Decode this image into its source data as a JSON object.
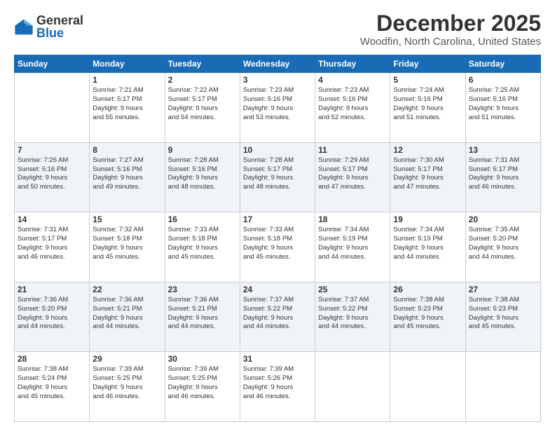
{
  "header": {
    "logo_general": "General",
    "logo_blue": "Blue",
    "month_title": "December 2025",
    "location": "Woodfin, North Carolina, United States"
  },
  "days_of_week": [
    "Sunday",
    "Monday",
    "Tuesday",
    "Wednesday",
    "Thursday",
    "Friday",
    "Saturday"
  ],
  "weeks": [
    [
      {
        "day": "",
        "info": ""
      },
      {
        "day": "1",
        "info": "Sunrise: 7:21 AM\nSunset: 5:17 PM\nDaylight: 9 hours\nand 55 minutes."
      },
      {
        "day": "2",
        "info": "Sunrise: 7:22 AM\nSunset: 5:17 PM\nDaylight: 9 hours\nand 54 minutes."
      },
      {
        "day": "3",
        "info": "Sunrise: 7:23 AM\nSunset: 5:16 PM\nDaylight: 9 hours\nand 53 minutes."
      },
      {
        "day": "4",
        "info": "Sunrise: 7:23 AM\nSunset: 5:16 PM\nDaylight: 9 hours\nand 52 minutes."
      },
      {
        "day": "5",
        "info": "Sunrise: 7:24 AM\nSunset: 5:16 PM\nDaylight: 9 hours\nand 51 minutes."
      },
      {
        "day": "6",
        "info": "Sunrise: 7:25 AM\nSunset: 5:16 PM\nDaylight: 9 hours\nand 51 minutes."
      }
    ],
    [
      {
        "day": "7",
        "info": "Sunrise: 7:26 AM\nSunset: 5:16 PM\nDaylight: 9 hours\nand 50 minutes."
      },
      {
        "day": "8",
        "info": "Sunrise: 7:27 AM\nSunset: 5:16 PM\nDaylight: 9 hours\nand 49 minutes."
      },
      {
        "day": "9",
        "info": "Sunrise: 7:28 AM\nSunset: 5:16 PM\nDaylight: 9 hours\nand 48 minutes."
      },
      {
        "day": "10",
        "info": "Sunrise: 7:28 AM\nSunset: 5:17 PM\nDaylight: 9 hours\nand 48 minutes."
      },
      {
        "day": "11",
        "info": "Sunrise: 7:29 AM\nSunset: 5:17 PM\nDaylight: 9 hours\nand 47 minutes."
      },
      {
        "day": "12",
        "info": "Sunrise: 7:30 AM\nSunset: 5:17 PM\nDaylight: 9 hours\nand 47 minutes."
      },
      {
        "day": "13",
        "info": "Sunrise: 7:31 AM\nSunset: 5:17 PM\nDaylight: 9 hours\nand 46 minutes."
      }
    ],
    [
      {
        "day": "14",
        "info": "Sunrise: 7:31 AM\nSunset: 5:17 PM\nDaylight: 9 hours\nand 46 minutes."
      },
      {
        "day": "15",
        "info": "Sunrise: 7:32 AM\nSunset: 5:18 PM\nDaylight: 9 hours\nand 45 minutes."
      },
      {
        "day": "16",
        "info": "Sunrise: 7:33 AM\nSunset: 5:18 PM\nDaylight: 9 hours\nand 45 minutes."
      },
      {
        "day": "17",
        "info": "Sunrise: 7:33 AM\nSunset: 5:18 PM\nDaylight: 9 hours\nand 45 minutes."
      },
      {
        "day": "18",
        "info": "Sunrise: 7:34 AM\nSunset: 5:19 PM\nDaylight: 9 hours\nand 44 minutes."
      },
      {
        "day": "19",
        "info": "Sunrise: 7:34 AM\nSunset: 5:19 PM\nDaylight: 9 hours\nand 44 minutes."
      },
      {
        "day": "20",
        "info": "Sunrise: 7:35 AM\nSunset: 5:20 PM\nDaylight: 9 hours\nand 44 minutes."
      }
    ],
    [
      {
        "day": "21",
        "info": "Sunrise: 7:36 AM\nSunset: 5:20 PM\nDaylight: 9 hours\nand 44 minutes."
      },
      {
        "day": "22",
        "info": "Sunrise: 7:36 AM\nSunset: 5:21 PM\nDaylight: 9 hours\nand 44 minutes."
      },
      {
        "day": "23",
        "info": "Sunrise: 7:36 AM\nSunset: 5:21 PM\nDaylight: 9 hours\nand 44 minutes."
      },
      {
        "day": "24",
        "info": "Sunrise: 7:37 AM\nSunset: 5:22 PM\nDaylight: 9 hours\nand 44 minutes."
      },
      {
        "day": "25",
        "info": "Sunrise: 7:37 AM\nSunset: 5:22 PM\nDaylight: 9 hours\nand 44 minutes."
      },
      {
        "day": "26",
        "info": "Sunrise: 7:38 AM\nSunset: 5:23 PM\nDaylight: 9 hours\nand 45 minutes."
      },
      {
        "day": "27",
        "info": "Sunrise: 7:38 AM\nSunset: 5:23 PM\nDaylight: 9 hours\nand 45 minutes."
      }
    ],
    [
      {
        "day": "28",
        "info": "Sunrise: 7:38 AM\nSunset: 5:24 PM\nDaylight: 9 hours\nand 45 minutes."
      },
      {
        "day": "29",
        "info": "Sunrise: 7:39 AM\nSunset: 5:25 PM\nDaylight: 9 hours\nand 46 minutes."
      },
      {
        "day": "30",
        "info": "Sunrise: 7:39 AM\nSunset: 5:25 PM\nDaylight: 9 hours\nand 46 minutes."
      },
      {
        "day": "31",
        "info": "Sunrise: 7:39 AM\nSunset: 5:26 PM\nDaylight: 9 hours\nand 46 minutes."
      },
      {
        "day": "",
        "info": ""
      },
      {
        "day": "",
        "info": ""
      },
      {
        "day": "",
        "info": ""
      }
    ]
  ]
}
